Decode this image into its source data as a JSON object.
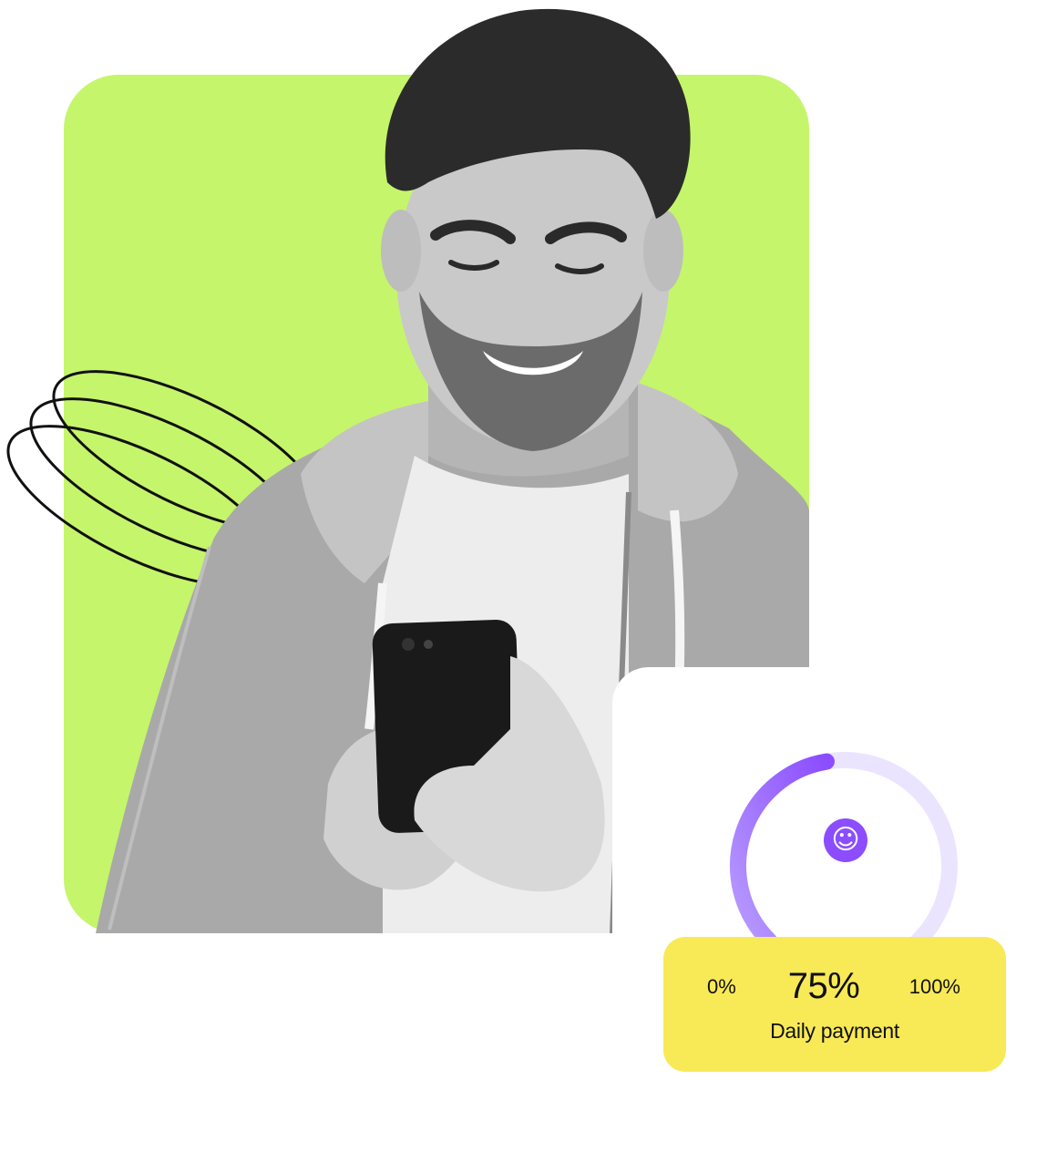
{
  "colors": {
    "background": "#ffffff",
    "green_panel": "#c5f56b",
    "gauge_active": "#8b4dff",
    "gauge_active_light": "#b89cff",
    "gauge_track": "#ebe4ff",
    "badge": "#8b4dff",
    "info_card": "#f8e957",
    "text": "#111111"
  },
  "gauge": {
    "progress": 0.75,
    "icon": "smiley-face-icon",
    "icon_glyph": "☺"
  },
  "info_card": {
    "min_label": "0%",
    "value_label": "75%",
    "max_label": "100%",
    "caption": "Daily payment"
  }
}
